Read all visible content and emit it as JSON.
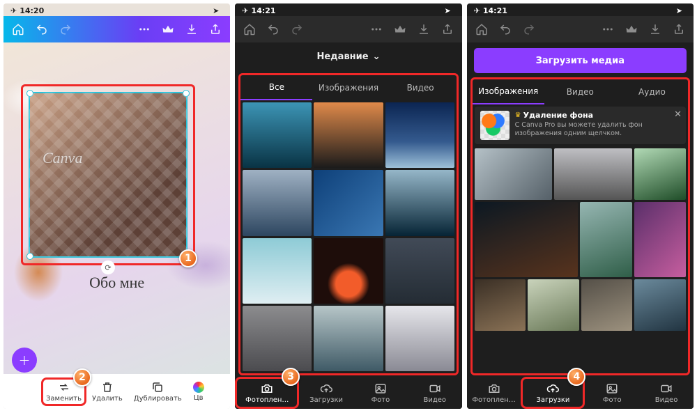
{
  "status": {
    "plane_icon": "✈︎",
    "wifi_icon": "wifi",
    "battery_icon": "battery"
  },
  "panel1": {
    "time": "14:20",
    "watermark": "Canva",
    "caption": "Обо мне",
    "badge1": "1",
    "badge2": "2",
    "toolbar_icons": [
      "home",
      "undo",
      "redo",
      "more",
      "crown",
      "download",
      "share"
    ],
    "fab_label": "+",
    "bottom": [
      {
        "id": "replace",
        "label": "Заменить",
        "icon": "swap"
      },
      {
        "id": "delete",
        "label": "Удалить",
        "icon": "trash"
      },
      {
        "id": "duplicate",
        "label": "Дублировать",
        "icon": "copy"
      },
      {
        "id": "color",
        "label": "Цв",
        "icon": "color"
      }
    ]
  },
  "panel2": {
    "time": "14:21",
    "recent_label": "Недавние",
    "badge": "3",
    "subtabs": [
      {
        "label": "Все",
        "active": true
      },
      {
        "label": "Изображения",
        "active": false
      },
      {
        "label": "Видео",
        "active": false
      }
    ],
    "tabs": [
      {
        "id": "camera",
        "label": "Фотоплен…",
        "active": true
      },
      {
        "id": "uploads",
        "label": "Загрузки",
        "active": false
      },
      {
        "id": "photo",
        "label": "Фото",
        "active": false
      },
      {
        "id": "video",
        "label": "Видео",
        "active": false
      }
    ]
  },
  "panel3": {
    "time": "14:21",
    "upload_label": "Загрузить медиа",
    "badge": "4",
    "subtabs": [
      {
        "label": "Изображения",
        "active": true
      },
      {
        "label": "Видео",
        "active": false
      },
      {
        "label": "Аудио",
        "active": false
      }
    ],
    "promo": {
      "title": "Удаление фона",
      "desc": "С Canva Pro вы можете удалить фон изображения одним щелчком.",
      "close": "✕"
    },
    "tabs": [
      {
        "id": "camera",
        "label": "Фотоплен…",
        "active": false
      },
      {
        "id": "uploads",
        "label": "Загрузки",
        "active": true
      },
      {
        "id": "photo",
        "label": "Фото",
        "active": false
      },
      {
        "id": "video",
        "label": "Видео",
        "active": false
      }
    ]
  }
}
